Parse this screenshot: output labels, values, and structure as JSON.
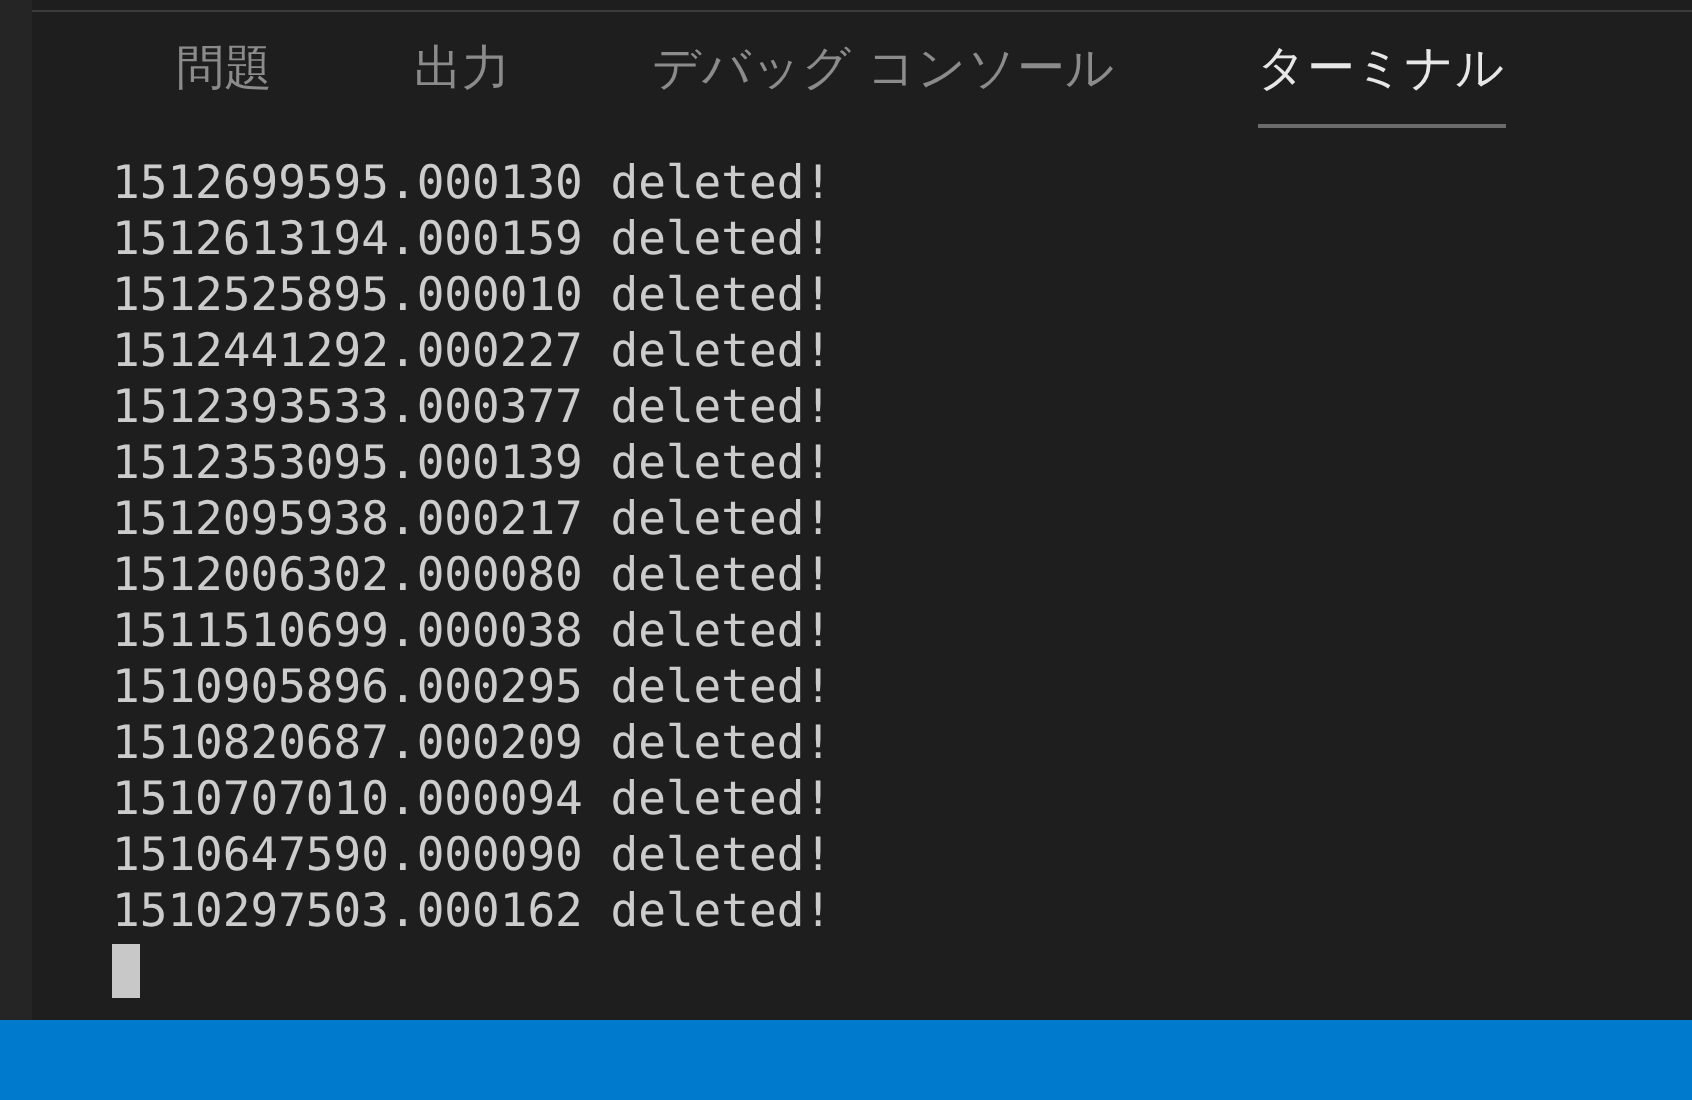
{
  "tabs": [
    {
      "label": "問題",
      "selected": false
    },
    {
      "label": "出力",
      "selected": false
    },
    {
      "label": "デバッグ コンソール",
      "selected": false
    },
    {
      "label": "ターミナル",
      "selected": true
    }
  ],
  "terminal": {
    "lines": [
      "1512699595.000130 deleted!",
      "1512613194.000159 deleted!",
      "1512525895.000010 deleted!",
      "1512441292.000227 deleted!",
      "1512393533.000377 deleted!",
      "1512353095.000139 deleted!",
      "1512095938.000217 deleted!",
      "1512006302.000080 deleted!",
      "1511510699.000038 deleted!",
      "1510905896.000295 deleted!",
      "1510820687.000209 deleted!",
      "1510707010.000094 deleted!",
      "1510647590.000090 deleted!",
      "1510297503.000162 deleted!"
    ]
  }
}
